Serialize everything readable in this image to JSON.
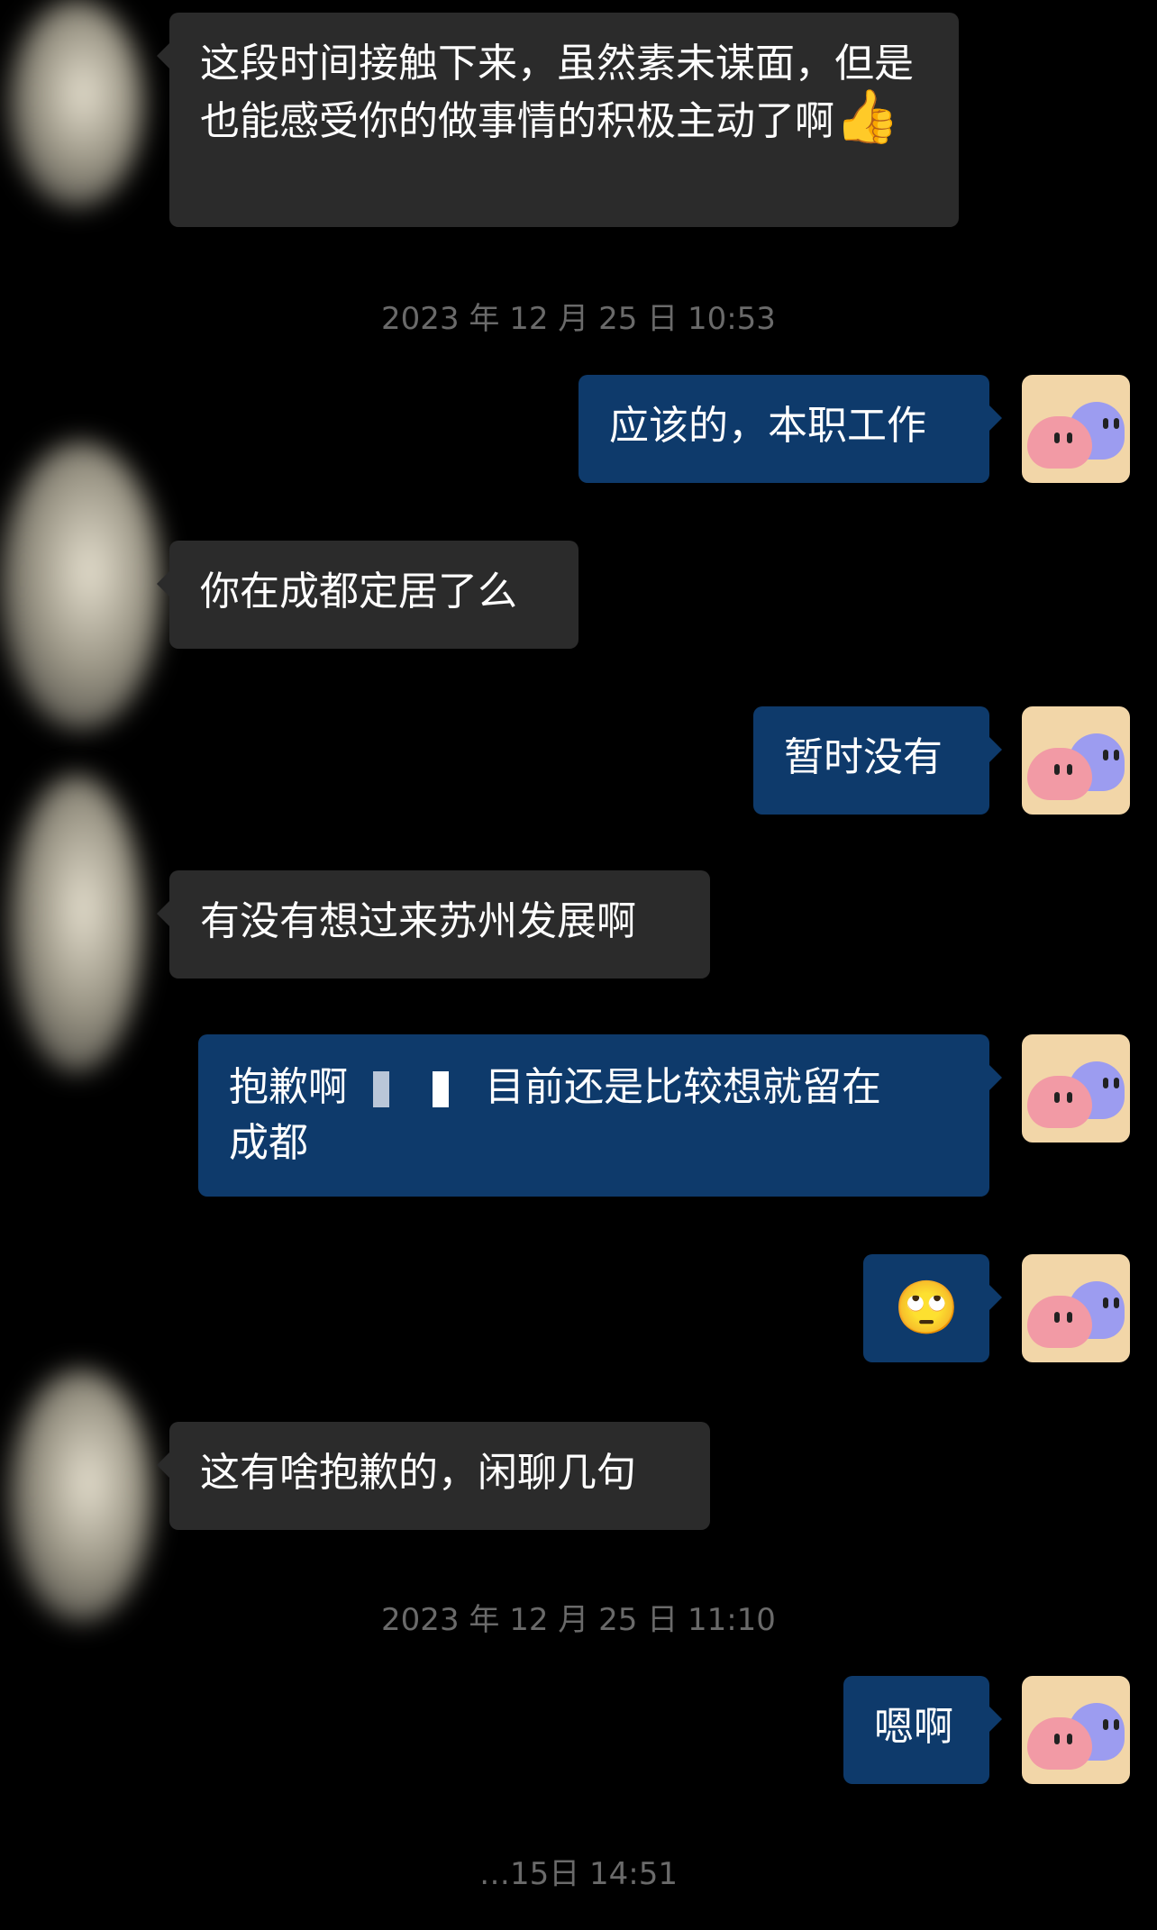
{
  "messages": [
    {
      "id": "m1",
      "side": "in",
      "text": "这段时间接触下来，虽然素未谋面，但是也能感受你的做事情的积极主动了啊",
      "emoji": "👍"
    },
    {
      "id": "ts1",
      "type": "timestamp",
      "text": "2023 年 12 月 25 日 10:53"
    },
    {
      "id": "m2",
      "side": "out",
      "text": "应该的，本职工作"
    },
    {
      "id": "m3",
      "side": "in",
      "text": "你在成都定居了么"
    },
    {
      "id": "m4",
      "side": "out",
      "text": "暂时没有"
    },
    {
      "id": "m5",
      "side": "in",
      "text": "有没有想过来苏州发展啊"
    },
    {
      "id": "m6",
      "side": "out",
      "text_a": "抱歉啊",
      "text_b": "目前还是比较想就留在",
      "text_c": "成都"
    },
    {
      "id": "m7",
      "side": "out",
      "emoji": "🙄"
    },
    {
      "id": "m8",
      "side": "in",
      "text": "这有啥抱歉的，闲聊几句"
    },
    {
      "id": "ts2",
      "type": "timestamp",
      "text": "2023 年 12 月 25 日 11:10"
    },
    {
      "id": "m9",
      "side": "out",
      "text": "嗯啊"
    },
    {
      "id": "ts3",
      "type": "timestamp",
      "text": "…15日 14:51"
    }
  ]
}
